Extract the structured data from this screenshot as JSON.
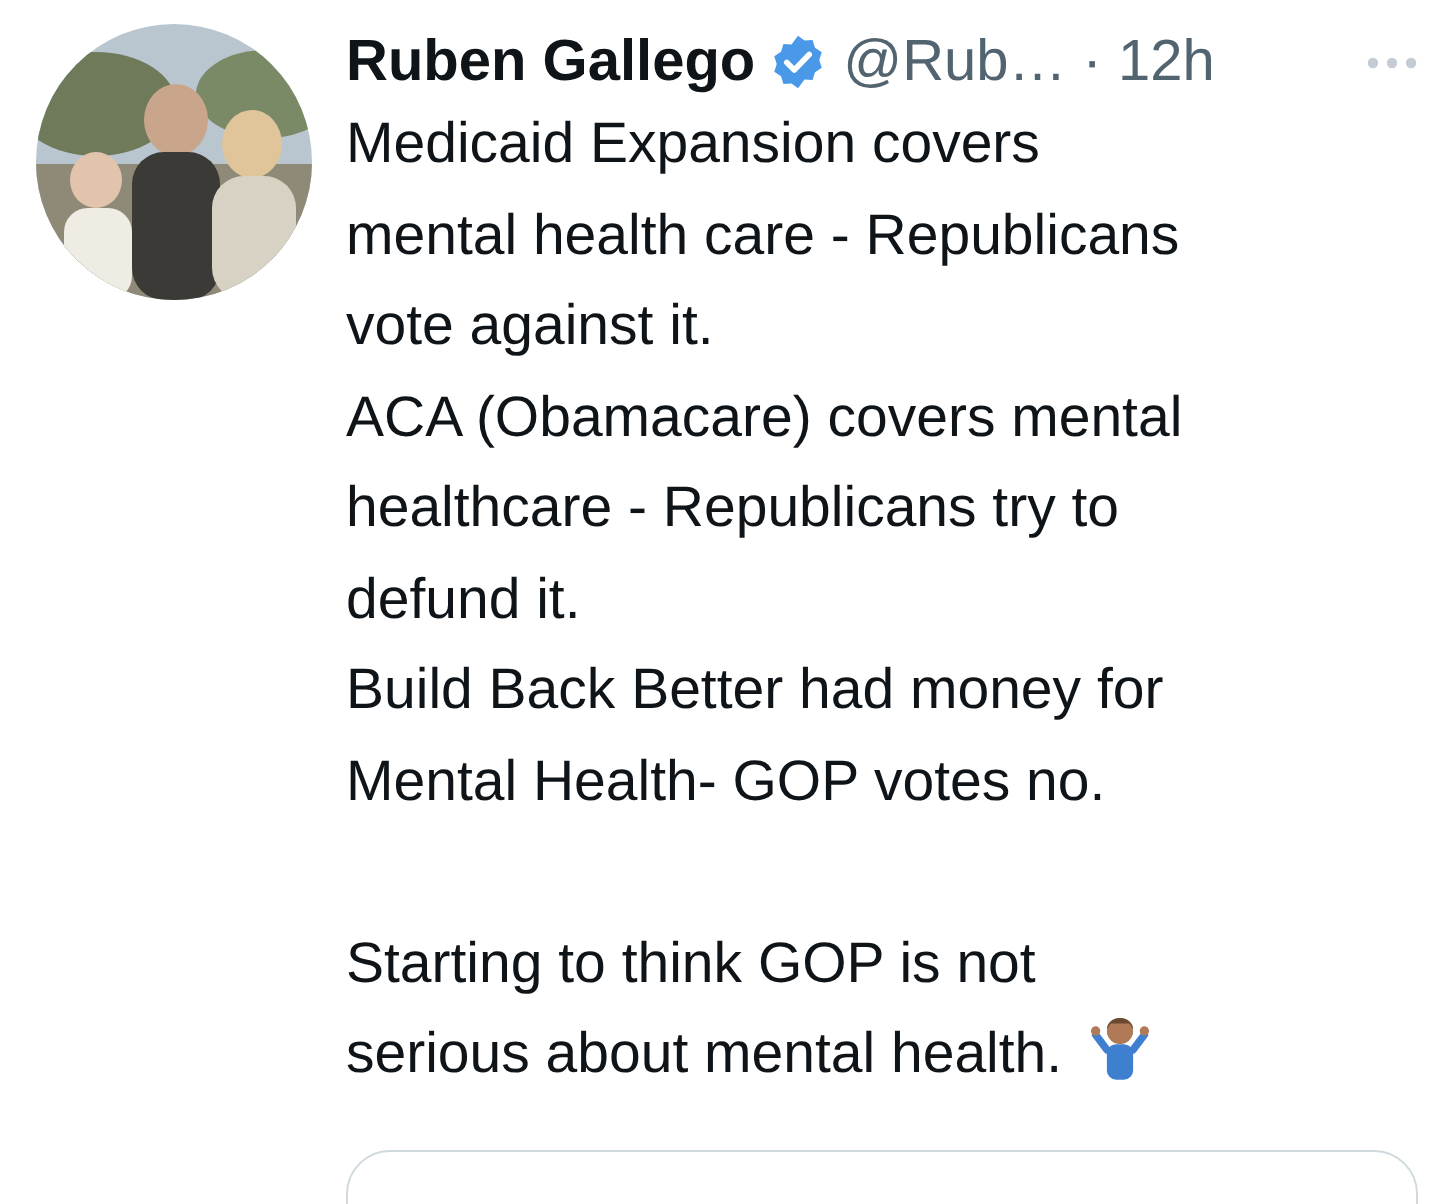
{
  "author": {
    "name": "Ruben Gallego",
    "verified": true,
    "handle": "@Rub…",
    "time": "· 12h"
  },
  "paragraphs": [
    {
      "space_before": false,
      "lines": [
        "Medicaid Expansion covers",
        "mental health care - Republicans",
        "vote against it."
      ]
    },
    {
      "space_before": false,
      "lines": [
        "ACA (Obamacare) covers mental",
        "healthcare - Republicans try to",
        "defund it."
      ]
    },
    {
      "space_before": false,
      "lines": [
        "Build Back Better had money for",
        "Mental Health- GOP votes no."
      ]
    },
    {
      "space_before": true,
      "lines": [
        "Starting to think GOP is not",
        "serious about mental health."
      ]
    }
  ]
}
